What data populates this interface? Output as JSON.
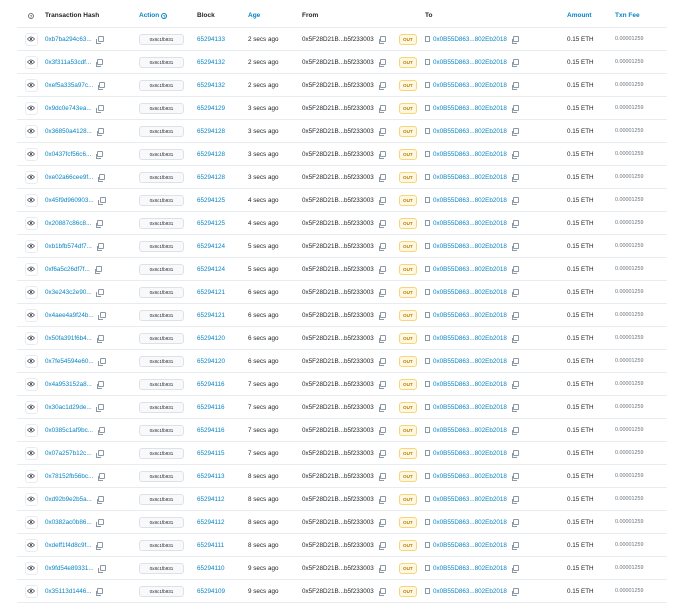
{
  "header": {
    "col_info_icon": "?",
    "col_hash": "Transaction Hash",
    "col_action": "Action",
    "col_block": "Block",
    "col_age": "Age",
    "col_from": "From",
    "col_to": "To",
    "col_amount": "Amount",
    "col_fee": "Txn Fee"
  },
  "colors": {
    "link": "#0784c3",
    "out_badge": "#b47d00"
  },
  "icons": {
    "eye": "eye-icon",
    "copy": "copy-icon",
    "contract": "document-icon",
    "info": "info-icon"
  },
  "rows": [
    {
      "hash": "0xb7ba294c63...",
      "method": "0x8c1fb931",
      "block": "65294133",
      "age": "2 secs ago",
      "from": "0x5F28D21B...b5f233003",
      "dir": "OUT",
      "to": "0x0B55D863...802Eb2018",
      "amount": "0.15 ETH",
      "fee": "0.00001259"
    },
    {
      "hash": "0x3f311a53cdf...",
      "method": "0x8c1fb931",
      "block": "65294132",
      "age": "2 secs ago",
      "from": "0x5F28D21B...b5f233003",
      "dir": "OUT",
      "to": "0x0B55D863...802Eb2018",
      "amount": "0.15 ETH",
      "fee": "0.00001259"
    },
    {
      "hash": "0xef5a335a97c...",
      "method": "0x8c1fb931",
      "block": "65294132",
      "age": "2 secs ago",
      "from": "0x5F28D21B...b5f233003",
      "dir": "OUT",
      "to": "0x0B55D863...802Eb2018",
      "amount": "0.15 ETH",
      "fee": "0.00001259"
    },
    {
      "hash": "0x9dc0e743ea...",
      "method": "0x8c1fb931",
      "block": "65294129",
      "age": "3 secs ago",
      "from": "0x5F28D21B...b5f233003",
      "dir": "OUT",
      "to": "0x0B55D863...802Eb2018",
      "amount": "0.15 ETH",
      "fee": "0.00001259"
    },
    {
      "hash": "0x36850a4128...",
      "method": "0x8c1fb931",
      "block": "65294128",
      "age": "3 secs ago",
      "from": "0x5F28D21B...b5f233003",
      "dir": "OUT",
      "to": "0x0B55D863...802Eb2018",
      "amount": "0.15 ETH",
      "fee": "0.00001259"
    },
    {
      "hash": "0x0437fcf56c6...",
      "method": "0x8c1fb931",
      "block": "65294128",
      "age": "3 secs ago",
      "from": "0x5F28D21B...b5f233003",
      "dir": "OUT",
      "to": "0x0B55D863...802Eb2018",
      "amount": "0.15 ETH",
      "fee": "0.00001259"
    },
    {
      "hash": "0xe02a66cee9f...",
      "method": "0x8c1fb931",
      "block": "65294128",
      "age": "3 secs ago",
      "from": "0x5F28D21B...b5f233003",
      "dir": "OUT",
      "to": "0x0B55D863...802Eb2018",
      "amount": "0.15 ETH",
      "fee": "0.00001259"
    },
    {
      "hash": "0x45f9d960903...",
      "method": "0x8c1fb931",
      "block": "65294125",
      "age": "4 secs ago",
      "from": "0x5F28D21B...b5f233003",
      "dir": "OUT",
      "to": "0x0B55D863...802Eb2018",
      "amount": "0.15 ETH",
      "fee": "0.00001259"
    },
    {
      "hash": "0x20887c86c8...",
      "method": "0x8c1fb931",
      "block": "65294125",
      "age": "4 secs ago",
      "from": "0x5F28D21B...b5f233003",
      "dir": "OUT",
      "to": "0x0B55D863...802Eb2018",
      "amount": "0.15 ETH",
      "fee": "0.00001259"
    },
    {
      "hash": "0xb1bfb574df7...",
      "method": "0x8c1fb931",
      "block": "65294124",
      "age": "5 secs ago",
      "from": "0x5F28D21B...b5f233003",
      "dir": "OUT",
      "to": "0x0B55D863...802Eb2018",
      "amount": "0.15 ETH",
      "fee": "0.00001259"
    },
    {
      "hash": "0xf6a5c26df7f...",
      "method": "0x8c1fb931",
      "block": "65294124",
      "age": "5 secs ago",
      "from": "0x5F28D21B...b5f233003",
      "dir": "OUT",
      "to": "0x0B55D863...802Eb2018",
      "amount": "0.15 ETH",
      "fee": "0.00001259"
    },
    {
      "hash": "0x3e243c2e90...",
      "method": "0x8c1fb931",
      "block": "65294121",
      "age": "6 secs ago",
      "from": "0x5F28D21B...b5f233003",
      "dir": "OUT",
      "to": "0x0B55D863...802Eb2018",
      "amount": "0.15 ETH",
      "fee": "0.00001259"
    },
    {
      "hash": "0x4aee4a9f24b...",
      "method": "0x8c1fb931",
      "block": "65294121",
      "age": "6 secs ago",
      "from": "0x5F28D21B...b5f233003",
      "dir": "OUT",
      "to": "0x0B55D863...802Eb2018",
      "amount": "0.15 ETH",
      "fee": "0.00001259"
    },
    {
      "hash": "0x50fa391f6b4...",
      "method": "0x8c1fb931",
      "block": "65294120",
      "age": "6 secs ago",
      "from": "0x5F28D21B...b5f233003",
      "dir": "OUT",
      "to": "0x0B55D863...802Eb2018",
      "amount": "0.15 ETH",
      "fee": "0.00001259"
    },
    {
      "hash": "0x7fe54594e60...",
      "method": "0x8c1fb931",
      "block": "65294120",
      "age": "6 secs ago",
      "from": "0x5F28D21B...b5f233003",
      "dir": "OUT",
      "to": "0x0B55D863...802Eb2018",
      "amount": "0.15 ETH",
      "fee": "0.00001259"
    },
    {
      "hash": "0x4a953152a8...",
      "method": "0x8c1fb931",
      "block": "65294116",
      "age": "7 secs ago",
      "from": "0x5F28D21B...b5f233003",
      "dir": "OUT",
      "to": "0x0B55D863...802Eb2018",
      "amount": "0.15 ETH",
      "fee": "0.00001259"
    },
    {
      "hash": "0x30ac1d29de...",
      "method": "0x8c1fb931",
      "block": "65294116",
      "age": "7 secs ago",
      "from": "0x5F28D21B...b5f233003",
      "dir": "OUT",
      "to": "0x0B55D863...802Eb2018",
      "amount": "0.15 ETH",
      "fee": "0.00001259"
    },
    {
      "hash": "0x0385c1af9bc...",
      "method": "0x8c1fb931",
      "block": "65294116",
      "age": "7 secs ago",
      "from": "0x5F28D21B...b5f233003",
      "dir": "OUT",
      "to": "0x0B55D863...802Eb2018",
      "amount": "0.15 ETH",
      "fee": "0.00001259"
    },
    {
      "hash": "0x07a257b12c...",
      "method": "0x8c1fb931",
      "block": "65294115",
      "age": "7 secs ago",
      "from": "0x5F28D21B...b5f233003",
      "dir": "OUT",
      "to": "0x0B55D863...802Eb2018",
      "amount": "0.15 ETH",
      "fee": "0.00001259"
    },
    {
      "hash": "0x78152fb56bc...",
      "method": "0x8c1fb931",
      "block": "65294113",
      "age": "8 secs ago",
      "from": "0x5F28D21B...b5f233003",
      "dir": "OUT",
      "to": "0x0B55D863...802Eb2018",
      "amount": "0.15 ETH",
      "fee": "0.00001259"
    },
    {
      "hash": "0xd92b9e2b5a...",
      "method": "0x8c1fb931",
      "block": "65294112",
      "age": "8 secs ago",
      "from": "0x5F28D21B...b5f233003",
      "dir": "OUT",
      "to": "0x0B55D863...802Eb2018",
      "amount": "0.15 ETH",
      "fee": "0.00001259"
    },
    {
      "hash": "0x0382ac0b86...",
      "method": "0x8c1fb931",
      "block": "65294112",
      "age": "8 secs ago",
      "from": "0x5F28D21B...b5f233003",
      "dir": "OUT",
      "to": "0x0B55D863...802Eb2018",
      "amount": "0.15 ETH",
      "fee": "0.00001259"
    },
    {
      "hash": "0xdeff1f4d8c9f...",
      "method": "0x8c1fb931",
      "block": "65294111",
      "age": "8 secs ago",
      "from": "0x5F28D21B...b5f233003",
      "dir": "OUT",
      "to": "0x0B55D863...802Eb2018",
      "amount": "0.15 ETH",
      "fee": "0.00001259"
    },
    {
      "hash": "0x9fd54e89331...",
      "method": "0x8c1fb931",
      "block": "65294110",
      "age": "9 secs ago",
      "from": "0x5F28D21B...b5f233003",
      "dir": "OUT",
      "to": "0x0B55D863...802Eb2018",
      "amount": "0.15 ETH",
      "fee": "0.00001259"
    },
    {
      "hash": "0x35113d1446...",
      "method": "0x8c1fb931",
      "block": "65294109",
      "age": "9 secs ago",
      "from": "0x5F28D21B...b5f233003",
      "dir": "OUT",
      "to": "0x0B55D863...802Eb2018",
      "amount": "0.15 ETH",
      "fee": "0.00001259"
    }
  ]
}
